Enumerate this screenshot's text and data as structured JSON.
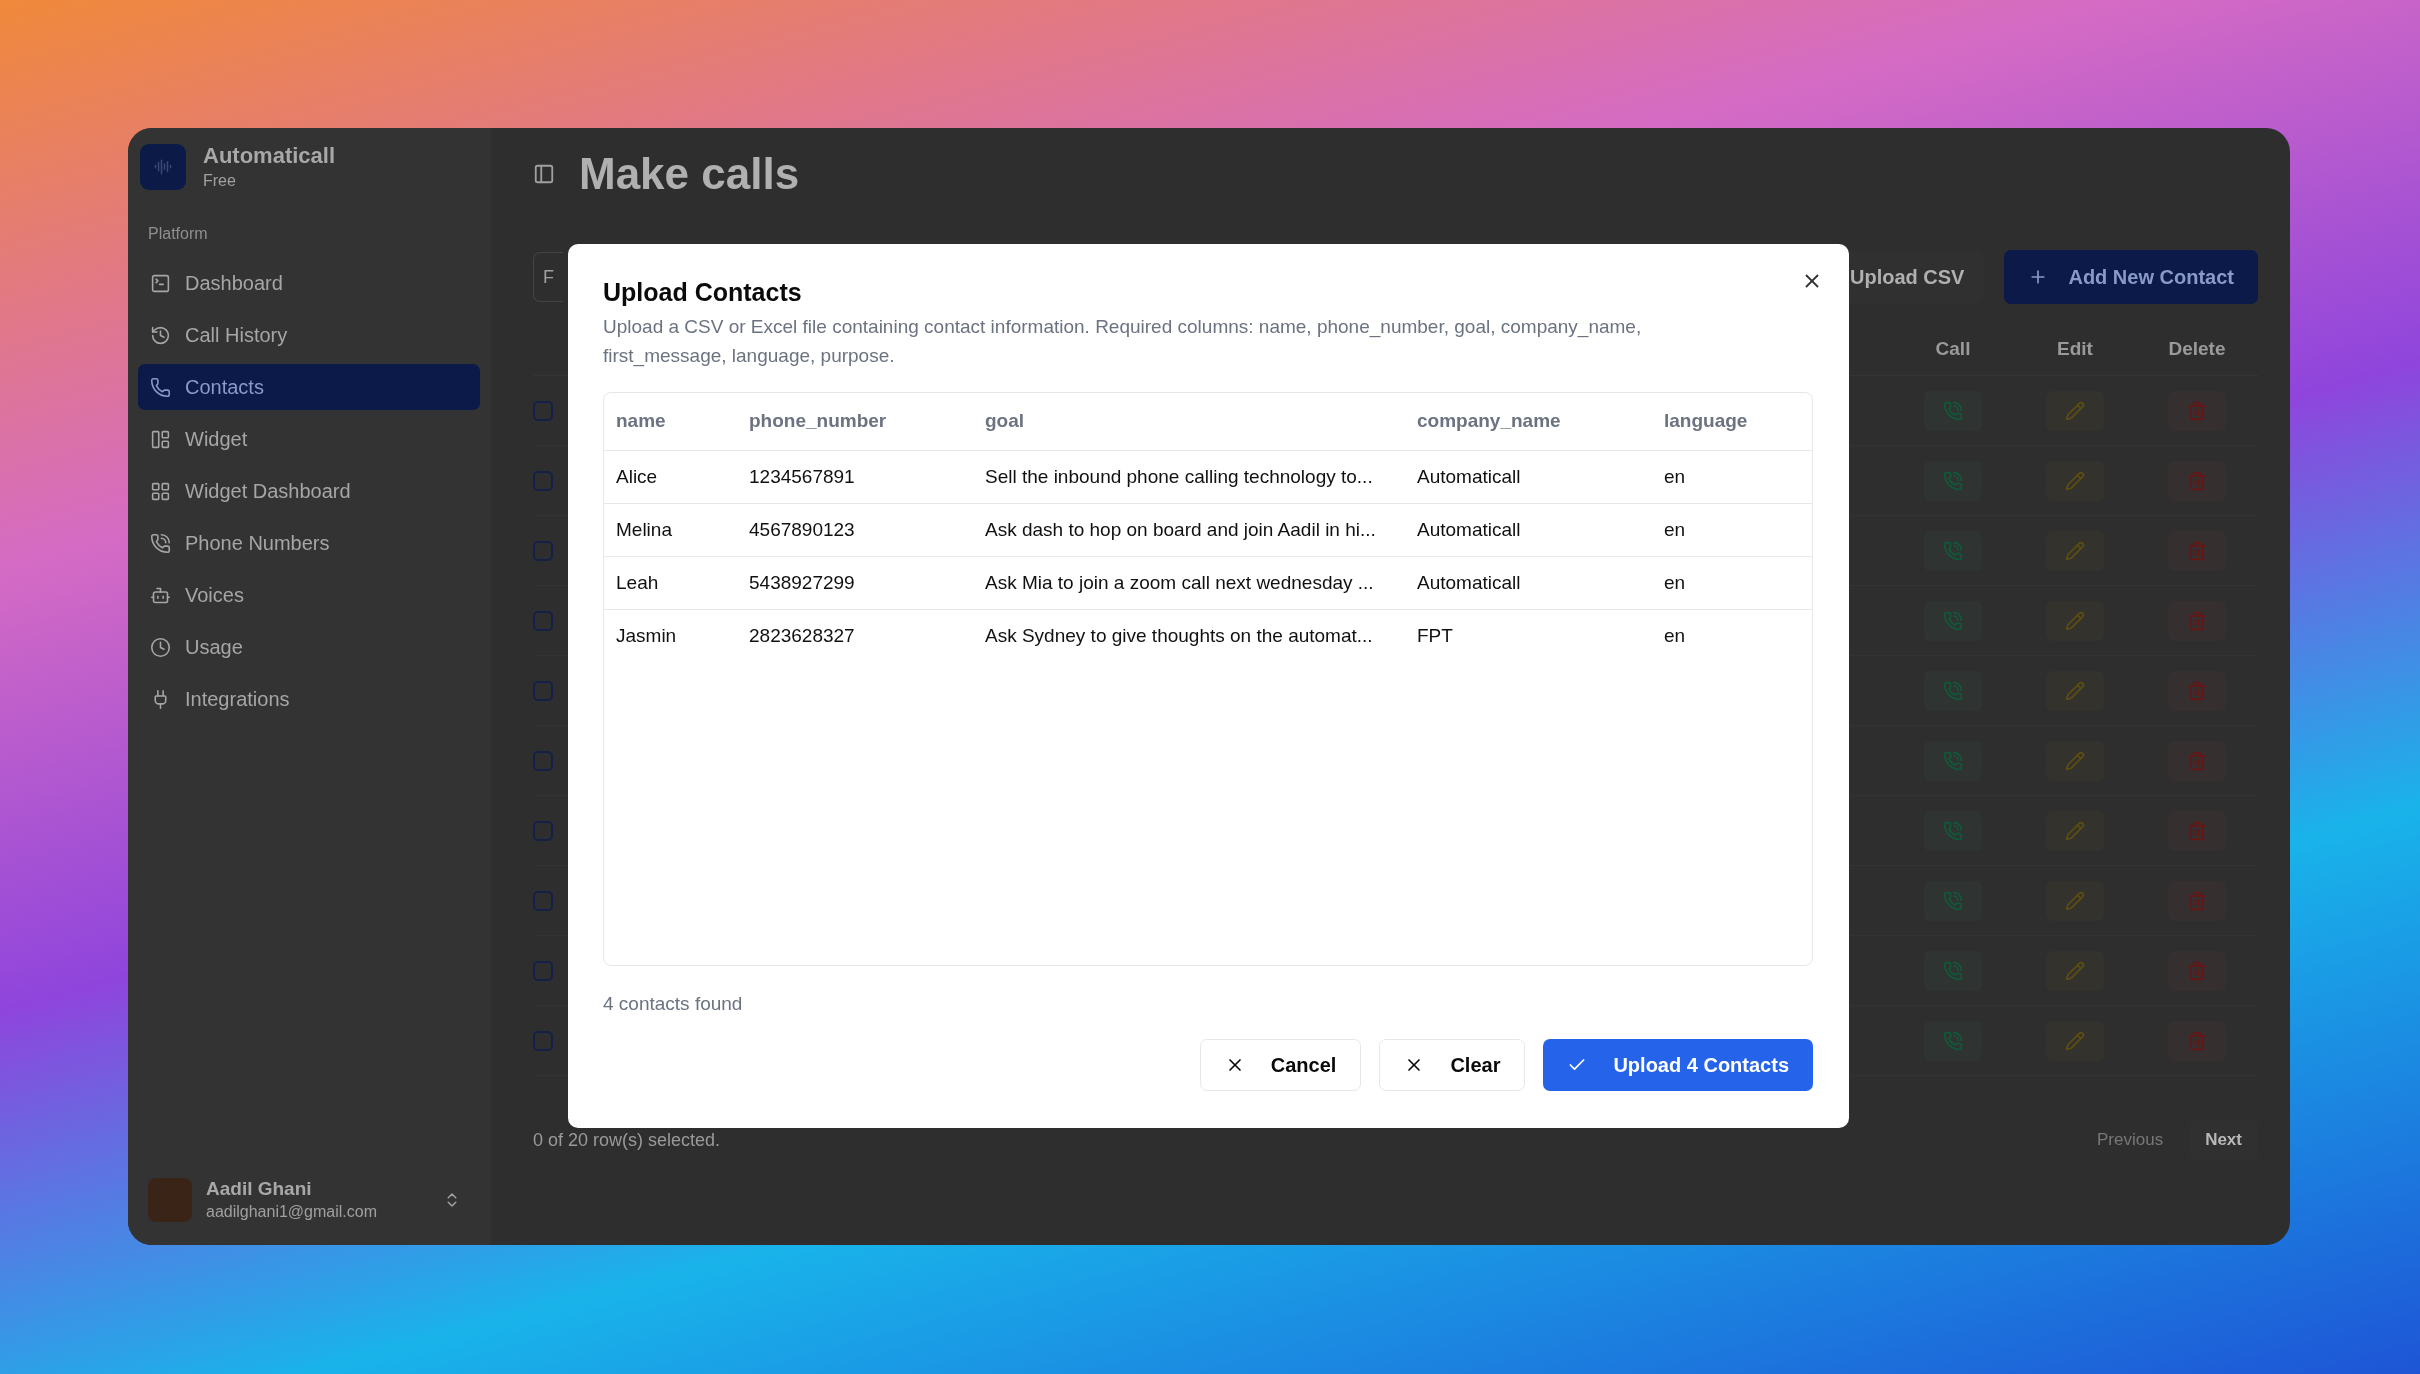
{
  "sidebar": {
    "app_name": "Automaticall",
    "plan": "Free",
    "section_label": "Platform",
    "items": [
      {
        "label": "Dashboard",
        "selected": false
      },
      {
        "label": "Call History",
        "selected": false
      },
      {
        "label": "Contacts",
        "selected": true
      },
      {
        "label": "Widget",
        "selected": false
      },
      {
        "label": "Widget Dashboard",
        "selected": false
      },
      {
        "label": "Phone Numbers",
        "selected": false
      },
      {
        "label": "Voices",
        "selected": false
      },
      {
        "label": "Usage",
        "selected": false
      },
      {
        "label": "Integrations",
        "selected": false
      }
    ],
    "user": {
      "name": "Aadil Ghani",
      "email": "aadilghani1@gmail.com"
    }
  },
  "page_title": "Make calls",
  "toolbar": {
    "filter_placeholder": "F",
    "upload_button": "Upload CSV",
    "add_button": "Add New Contact"
  },
  "contacts_table": {
    "columns": [
      "Call",
      "Edit",
      "Delete"
    ],
    "rows": [
      {
        "checked": false
      },
      {
        "checked": false
      },
      {
        "checked": false
      },
      {
        "checked": false
      },
      {
        "checked": false
      },
      {
        "checked": false
      },
      {
        "checked": false
      },
      {
        "checked": false
      },
      {
        "checked": false
      },
      {
        "checked": false
      }
    ]
  },
  "footer": {
    "selection": "0 of 20 row(s) selected.",
    "previous": {
      "label": "Previous",
      "disabled": true
    },
    "next": {
      "label": "Next",
      "disabled": false
    }
  },
  "dialog": {
    "title": "Upload Contacts",
    "description": "Upload a CSV or Excel file containing contact information. Required columns: name, phone_number, goal, company_name, first_message, language, purpose.",
    "table": {
      "columns": [
        "name",
        "phone_number",
        "goal",
        "company_name",
        "language"
      ],
      "rows": [
        [
          "Alice",
          "1234567891",
          "Sell the inbound phone calling technology to...",
          "Automaticall",
          "en"
        ],
        [
          "Melina",
          "4567890123",
          "Ask dash to hop on board and join Aadil in hi...",
          "Automaticall",
          "en"
        ],
        [
          "Leah",
          "5438927299",
          "Ask Mia to join a zoom call next wednesday ...",
          "Automaticall",
          "en"
        ],
        [
          "Jasmin",
          "2823628327",
          "Ask Sydney to give thoughts on the automat...",
          "FPT",
          "en"
        ]
      ]
    },
    "count": "4 contacts found",
    "cancel": "Cancel",
    "clear": "Clear",
    "upload": "Upload 4 Contacts"
  }
}
